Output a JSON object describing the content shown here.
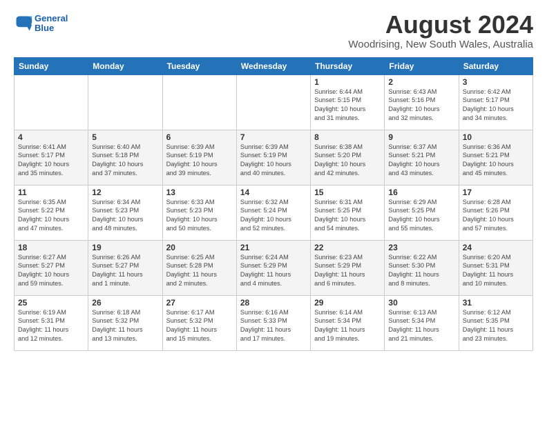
{
  "logo": {
    "line1": "General",
    "line2": "Blue"
  },
  "title": "August 2024",
  "location": "Woodrising, New South Wales, Australia",
  "weekdays": [
    "Sunday",
    "Monday",
    "Tuesday",
    "Wednesday",
    "Thursday",
    "Friday",
    "Saturday"
  ],
  "weeks": [
    [
      {
        "day": "",
        "info": ""
      },
      {
        "day": "",
        "info": ""
      },
      {
        "day": "",
        "info": ""
      },
      {
        "day": "",
        "info": ""
      },
      {
        "day": "1",
        "info": "Sunrise: 6:44 AM\nSunset: 5:15 PM\nDaylight: 10 hours\nand 31 minutes."
      },
      {
        "day": "2",
        "info": "Sunrise: 6:43 AM\nSunset: 5:16 PM\nDaylight: 10 hours\nand 32 minutes."
      },
      {
        "day": "3",
        "info": "Sunrise: 6:42 AM\nSunset: 5:17 PM\nDaylight: 10 hours\nand 34 minutes."
      }
    ],
    [
      {
        "day": "4",
        "info": "Sunrise: 6:41 AM\nSunset: 5:17 PM\nDaylight: 10 hours\nand 35 minutes."
      },
      {
        "day": "5",
        "info": "Sunrise: 6:40 AM\nSunset: 5:18 PM\nDaylight: 10 hours\nand 37 minutes."
      },
      {
        "day": "6",
        "info": "Sunrise: 6:39 AM\nSunset: 5:19 PM\nDaylight: 10 hours\nand 39 minutes."
      },
      {
        "day": "7",
        "info": "Sunrise: 6:39 AM\nSunset: 5:19 PM\nDaylight: 10 hours\nand 40 minutes."
      },
      {
        "day": "8",
        "info": "Sunrise: 6:38 AM\nSunset: 5:20 PM\nDaylight: 10 hours\nand 42 minutes."
      },
      {
        "day": "9",
        "info": "Sunrise: 6:37 AM\nSunset: 5:21 PM\nDaylight: 10 hours\nand 43 minutes."
      },
      {
        "day": "10",
        "info": "Sunrise: 6:36 AM\nSunset: 5:21 PM\nDaylight: 10 hours\nand 45 minutes."
      }
    ],
    [
      {
        "day": "11",
        "info": "Sunrise: 6:35 AM\nSunset: 5:22 PM\nDaylight: 10 hours\nand 47 minutes."
      },
      {
        "day": "12",
        "info": "Sunrise: 6:34 AM\nSunset: 5:23 PM\nDaylight: 10 hours\nand 48 minutes."
      },
      {
        "day": "13",
        "info": "Sunrise: 6:33 AM\nSunset: 5:23 PM\nDaylight: 10 hours\nand 50 minutes."
      },
      {
        "day": "14",
        "info": "Sunrise: 6:32 AM\nSunset: 5:24 PM\nDaylight: 10 hours\nand 52 minutes."
      },
      {
        "day": "15",
        "info": "Sunrise: 6:31 AM\nSunset: 5:25 PM\nDaylight: 10 hours\nand 54 minutes."
      },
      {
        "day": "16",
        "info": "Sunrise: 6:29 AM\nSunset: 5:25 PM\nDaylight: 10 hours\nand 55 minutes."
      },
      {
        "day": "17",
        "info": "Sunrise: 6:28 AM\nSunset: 5:26 PM\nDaylight: 10 hours\nand 57 minutes."
      }
    ],
    [
      {
        "day": "18",
        "info": "Sunrise: 6:27 AM\nSunset: 5:27 PM\nDaylight: 10 hours\nand 59 minutes."
      },
      {
        "day": "19",
        "info": "Sunrise: 6:26 AM\nSunset: 5:27 PM\nDaylight: 11 hours\nand 1 minute."
      },
      {
        "day": "20",
        "info": "Sunrise: 6:25 AM\nSunset: 5:28 PM\nDaylight: 11 hours\nand 2 minutes."
      },
      {
        "day": "21",
        "info": "Sunrise: 6:24 AM\nSunset: 5:29 PM\nDaylight: 11 hours\nand 4 minutes."
      },
      {
        "day": "22",
        "info": "Sunrise: 6:23 AM\nSunset: 5:29 PM\nDaylight: 11 hours\nand 6 minutes."
      },
      {
        "day": "23",
        "info": "Sunrise: 6:22 AM\nSunset: 5:30 PM\nDaylight: 11 hours\nand 8 minutes."
      },
      {
        "day": "24",
        "info": "Sunrise: 6:20 AM\nSunset: 5:31 PM\nDaylight: 11 hours\nand 10 minutes."
      }
    ],
    [
      {
        "day": "25",
        "info": "Sunrise: 6:19 AM\nSunset: 5:31 PM\nDaylight: 11 hours\nand 12 minutes."
      },
      {
        "day": "26",
        "info": "Sunrise: 6:18 AM\nSunset: 5:32 PM\nDaylight: 11 hours\nand 13 minutes."
      },
      {
        "day": "27",
        "info": "Sunrise: 6:17 AM\nSunset: 5:32 PM\nDaylight: 11 hours\nand 15 minutes."
      },
      {
        "day": "28",
        "info": "Sunrise: 6:16 AM\nSunset: 5:33 PM\nDaylight: 11 hours\nand 17 minutes."
      },
      {
        "day": "29",
        "info": "Sunrise: 6:14 AM\nSunset: 5:34 PM\nDaylight: 11 hours\nand 19 minutes."
      },
      {
        "day": "30",
        "info": "Sunrise: 6:13 AM\nSunset: 5:34 PM\nDaylight: 11 hours\nand 21 minutes."
      },
      {
        "day": "31",
        "info": "Sunrise: 6:12 AM\nSunset: 5:35 PM\nDaylight: 11 hours\nand 23 minutes."
      }
    ]
  ]
}
